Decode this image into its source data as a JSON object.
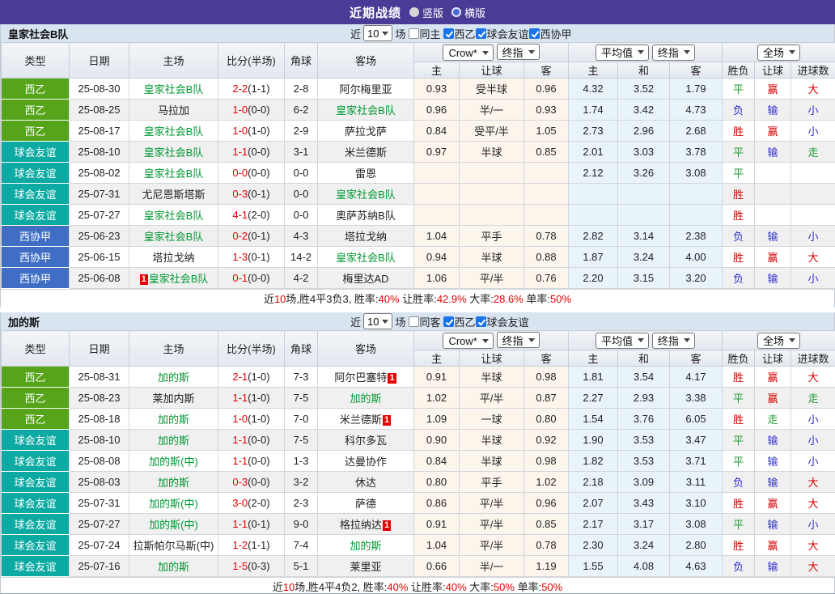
{
  "title_bar": {
    "title": "近期战绩",
    "options": [
      {
        "label": "竖版",
        "selected": false
      },
      {
        "label": "横版",
        "selected": true
      }
    ]
  },
  "columns": {
    "type": "类型",
    "date": "日期",
    "home": "主场",
    "score": "比分(半场)",
    "corner": "角球",
    "away": "客场",
    "odds_select": "Crow*",
    "odds_select2": "终指",
    "avg_select": "平均值",
    "avg_select2": "终指",
    "result_select": "全场",
    "odds_sub": [
      "主",
      "让球",
      "客"
    ],
    "avg_sub": [
      "主",
      "和",
      "客"
    ],
    "result_sub": [
      "胜负",
      "让球",
      "进球数"
    ]
  },
  "colors": {
    "titlebar": "#4a3c96",
    "team_green": "#009933",
    "score_red": "#e60000",
    "card_bg": "#e60000",
    "type_badges": {
      "西乙": "#55a419",
      "球会友谊": "#0caaa2",
      "西协甲": "#3f6ec4"
    },
    "outcome": {
      "胜": "#d60000",
      "赢": "#d60000",
      "大": "#d60000",
      "平": "#1e9e30",
      "走": "#1e9e30",
      "负": "#3030cf",
      "输": "#3030cf",
      "小": "#3030cf"
    }
  },
  "card_label": "1",
  "tables": [
    {
      "team": "皇家社会B队",
      "filter": {
        "near": "近",
        "count": "10",
        "games": "场",
        "same": "同主",
        "same_checked": false,
        "leagues": [
          {
            "label": "西乙",
            "checked": true
          },
          {
            "label": "球会友谊",
            "checked": true
          },
          {
            "label": "西协甲",
            "checked": true
          }
        ]
      },
      "rows": [
        {
          "type": "西乙",
          "date": "25-08-30",
          "home": "皇家社会B队",
          "home_hl": true,
          "home_card": false,
          "score": "2-2",
          "half": "(1-1)",
          "corner": "2-8",
          "away": "阿尔梅里亚",
          "away_hl": false,
          "away_card": false,
          "odds": [
            "0.93",
            "受半球",
            "0.96"
          ],
          "avg": [
            "4.32",
            "3.52",
            "1.79"
          ],
          "results": [
            "平",
            "赢",
            "大"
          ]
        },
        {
          "type": "西乙",
          "date": "25-08-25",
          "home": "马拉加",
          "home_hl": false,
          "home_card": false,
          "score": "1-0",
          "half": "(0-0)",
          "corner": "6-2",
          "away": "皇家社会B队",
          "away_hl": true,
          "away_card": false,
          "odds": [
            "0.96",
            "半/一",
            "0.93"
          ],
          "avg": [
            "1.74",
            "3.42",
            "4.73"
          ],
          "results": [
            "负",
            "输",
            "小"
          ]
        },
        {
          "type": "西乙",
          "date": "25-08-17",
          "home": "皇家社会B队",
          "home_hl": true,
          "home_card": false,
          "score": "1-0",
          "half": "(1-0)",
          "corner": "2-9",
          "away": "萨拉戈萨",
          "away_hl": false,
          "away_card": false,
          "odds": [
            "0.84",
            "受平/半",
            "1.05"
          ],
          "avg": [
            "2.73",
            "2.96",
            "2.68"
          ],
          "results": [
            "胜",
            "赢",
            "小"
          ]
        },
        {
          "type": "球会友谊",
          "date": "25-08-10",
          "home": "皇家社会B队",
          "home_hl": true,
          "home_card": false,
          "score": "1-1",
          "half": "(0-0)",
          "corner": "3-1",
          "away": "米兰德斯",
          "away_hl": false,
          "away_card": false,
          "odds": [
            "0.97",
            "半球",
            "0.85"
          ],
          "avg": [
            "2.01",
            "3.03",
            "3.78"
          ],
          "results": [
            "平",
            "输",
            "走"
          ]
        },
        {
          "type": "球会友谊",
          "date": "25-08-02",
          "home": "皇家社会B队",
          "home_hl": true,
          "home_card": false,
          "score": "0-0",
          "half": "(0-0)",
          "corner": "0-0",
          "away": "雷恩",
          "away_hl": false,
          "away_card": false,
          "odds": [
            "",
            "",
            ""
          ],
          "avg": [
            "2.12",
            "3.26",
            "3.08"
          ],
          "results": [
            "平",
            "",
            ""
          ]
        },
        {
          "type": "球会友谊",
          "date": "25-07-31",
          "home": "尤尼恩斯塔斯",
          "home_hl": false,
          "home_card": false,
          "score": "0-3",
          "half": "(0-1)",
          "corner": "0-0",
          "away": "皇家社会B队",
          "away_hl": true,
          "away_card": false,
          "odds": [
            "",
            "",
            ""
          ],
          "avg": [
            "",
            "",
            ""
          ],
          "results": [
            "胜",
            "",
            ""
          ]
        },
        {
          "type": "球会友谊",
          "date": "25-07-27",
          "home": "皇家社会B队",
          "home_hl": true,
          "home_card": false,
          "score": "4-1",
          "half": "(2-0)",
          "corner": "0-0",
          "away": "奥萨苏纳B队",
          "away_hl": false,
          "away_card": false,
          "odds": [
            "",
            "",
            ""
          ],
          "avg": [
            "",
            "",
            ""
          ],
          "results": [
            "胜",
            "",
            ""
          ]
        },
        {
          "type": "西协甲",
          "date": "25-06-23",
          "home": "皇家社会B队",
          "home_hl": true,
          "home_card": false,
          "score": "0-2",
          "half": "(0-1)",
          "corner": "4-3",
          "away": "塔拉戈纳",
          "away_hl": false,
          "away_card": false,
          "odds": [
            "1.04",
            "平手",
            "0.78"
          ],
          "avg": [
            "2.82",
            "3.14",
            "2.38"
          ],
          "results": [
            "负",
            "输",
            "小"
          ]
        },
        {
          "type": "西协甲",
          "date": "25-06-15",
          "home": "塔拉戈纳",
          "home_hl": false,
          "home_card": false,
          "score": "1-3",
          "half": "(0-1)",
          "corner": "14-2",
          "away": "皇家社会B队",
          "away_hl": true,
          "away_card": false,
          "odds": [
            "0.94",
            "半球",
            "0.88"
          ],
          "avg": [
            "1.87",
            "3.24",
            "4.00"
          ],
          "results": [
            "胜",
            "赢",
            "大"
          ]
        },
        {
          "type": "西协甲",
          "date": "25-06-08",
          "home": "皇家社会B队",
          "home_hl": true,
          "home_card": true,
          "score": "0-1",
          "half": "(0-0)",
          "corner": "4-2",
          "away": "梅里达AD",
          "away_hl": false,
          "away_card": false,
          "odds": [
            "1.06",
            "平/半",
            "0.76"
          ],
          "avg": [
            "2.20",
            "3.15",
            "3.20"
          ],
          "results": [
            "负",
            "输",
            "小"
          ]
        }
      ],
      "summary": [
        {
          "text": "近"
        },
        {
          "text": "10",
          "red": true
        },
        {
          "text": "场,胜4平3负3, 胜率:"
        },
        {
          "text": "40%",
          "red": true
        },
        {
          "text": " 让胜率:"
        },
        {
          "text": "42.9%",
          "red": true
        },
        {
          "text": " 大率:"
        },
        {
          "text": "28.6%",
          "red": true
        },
        {
          "text": " 单率:"
        },
        {
          "text": "50%",
          "red": true
        }
      ]
    },
    {
      "team": "加的斯",
      "filter": {
        "near": "近",
        "count": "10",
        "games": "场",
        "same": "同客",
        "same_checked": false,
        "leagues": [
          {
            "label": "西乙",
            "checked": true
          },
          {
            "label": "球会友谊",
            "checked": true
          }
        ]
      },
      "rows": [
        {
          "type": "西乙",
          "date": "25-08-31",
          "home": "加的斯",
          "home_hl": true,
          "home_card": false,
          "score": "2-1",
          "half": "(1-0)",
          "corner": "7-3",
          "away": "阿尔巴塞特",
          "away_hl": false,
          "away_card": true,
          "odds": [
            "0.91",
            "半球",
            "0.98"
          ],
          "avg": [
            "1.81",
            "3.54",
            "4.17"
          ],
          "results": [
            "胜",
            "赢",
            "大"
          ]
        },
        {
          "type": "西乙",
          "date": "25-08-23",
          "home": "莱加内斯",
          "home_hl": false,
          "home_card": false,
          "score": "1-1",
          "half": "(1-0)",
          "corner": "7-5",
          "away": "加的斯",
          "away_hl": true,
          "away_card": false,
          "odds": [
            "1.02",
            "平/半",
            "0.87"
          ],
          "avg": [
            "2.27",
            "2.93",
            "3.38"
          ],
          "results": [
            "平",
            "赢",
            "走"
          ]
        },
        {
          "type": "西乙",
          "date": "25-08-18",
          "home": "加的斯",
          "home_hl": true,
          "home_card": false,
          "score": "1-0",
          "half": "(1-0)",
          "corner": "7-0",
          "away": "米兰德斯",
          "away_hl": false,
          "away_card": true,
          "odds": [
            "1.09",
            "一球",
            "0.80"
          ],
          "avg": [
            "1.54",
            "3.76",
            "6.05"
          ],
          "results": [
            "胜",
            "走",
            "小"
          ]
        },
        {
          "type": "球会友谊",
          "date": "25-08-10",
          "home": "加的斯",
          "home_hl": true,
          "home_card": false,
          "score": "1-1",
          "half": "(0-0)",
          "corner": "7-5",
          "away": "科尔多瓦",
          "away_hl": false,
          "away_card": false,
          "odds": [
            "0.90",
            "半球",
            "0.92"
          ],
          "avg": [
            "1.90",
            "3.53",
            "3.47"
          ],
          "results": [
            "平",
            "输",
            "小"
          ]
        },
        {
          "type": "球会友谊",
          "date": "25-08-08",
          "home": "加的斯(中)",
          "home_hl": true,
          "home_card": false,
          "score": "1-1",
          "half": "(0-0)",
          "corner": "1-3",
          "away": "达曼协作",
          "away_hl": false,
          "away_card": false,
          "odds": [
            "0.84",
            "半球",
            "0.98"
          ],
          "avg": [
            "1.82",
            "3.53",
            "3.71"
          ],
          "results": [
            "平",
            "输",
            "小"
          ]
        },
        {
          "type": "球会友谊",
          "date": "25-08-03",
          "home": "加的斯",
          "home_hl": true,
          "home_card": false,
          "score": "0-3",
          "half": "(0-0)",
          "corner": "3-2",
          "away": "休达",
          "away_hl": false,
          "away_card": false,
          "odds": [
            "0.80",
            "平手",
            "1.02"
          ],
          "avg": [
            "2.18",
            "3.09",
            "3.11"
          ],
          "results": [
            "负",
            "输",
            "大"
          ]
        },
        {
          "type": "球会友谊",
          "date": "25-07-31",
          "home": "加的斯(中)",
          "home_hl": true,
          "home_card": false,
          "score": "3-0",
          "half": "(2-0)",
          "corner": "2-3",
          "away": "萨德",
          "away_hl": false,
          "away_card": false,
          "odds": [
            "0.86",
            "平/半",
            "0.96"
          ],
          "avg": [
            "2.07",
            "3.43",
            "3.10"
          ],
          "results": [
            "胜",
            "赢",
            "大"
          ]
        },
        {
          "type": "球会友谊",
          "date": "25-07-27",
          "home": "加的斯(中)",
          "home_hl": true,
          "home_card": false,
          "score": "1-1",
          "half": "(0-1)",
          "corner": "9-0",
          "away": "格拉纳达",
          "away_hl": false,
          "away_card": true,
          "odds": [
            "0.91",
            "平/半",
            "0.85"
          ],
          "avg": [
            "2.17",
            "3.17",
            "3.08"
          ],
          "results": [
            "平",
            "输",
            "小"
          ]
        },
        {
          "type": "球会友谊",
          "date": "25-07-24",
          "home": "拉斯帕尔马斯(中)",
          "home_hl": false,
          "home_card": false,
          "score": "1-2",
          "half": "(1-1)",
          "corner": "7-4",
          "away": "加的斯",
          "away_hl": true,
          "away_card": false,
          "odds": [
            "1.04",
            "平/半",
            "0.78"
          ],
          "avg": [
            "2.30",
            "3.24",
            "2.80"
          ],
          "results": [
            "胜",
            "赢",
            "大"
          ]
        },
        {
          "type": "球会友谊",
          "date": "25-07-16",
          "home": "加的斯",
          "home_hl": true,
          "home_card": false,
          "score": "1-5",
          "half": "(0-3)",
          "corner": "5-1",
          "away": "莱里亚",
          "away_hl": false,
          "away_card": false,
          "odds": [
            "0.66",
            "半/一",
            "1.19"
          ],
          "avg": [
            "1.55",
            "4.08",
            "4.63"
          ],
          "results": [
            "负",
            "输",
            "大"
          ]
        }
      ],
      "summary": [
        {
          "text": "近"
        },
        {
          "text": "10",
          "red": true
        },
        {
          "text": "场,胜4平4负2, 胜率:"
        },
        {
          "text": "40%",
          "red": true
        },
        {
          "text": " 让胜率:"
        },
        {
          "text": "40%",
          "red": true
        },
        {
          "text": " 大率:"
        },
        {
          "text": "50%",
          "red": true
        },
        {
          "text": " 单率:"
        },
        {
          "text": "50%",
          "red": true
        }
      ]
    }
  ]
}
